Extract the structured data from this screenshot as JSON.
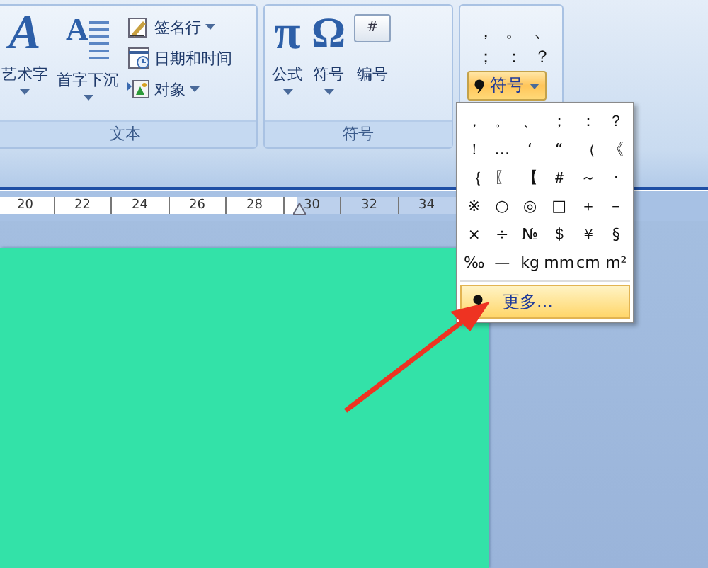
{
  "ribbon": {
    "groups": [
      {
        "label": "文本",
        "items": [
          {
            "kind": "large",
            "icon": "A",
            "label": "艺术字",
            "dropdown": true
          },
          {
            "kind": "large",
            "icon": "A",
            "label": "首字下沉",
            "dropdown": true
          },
          {
            "kind": "small",
            "label": "签名行",
            "dropdown": true
          },
          {
            "kind": "small",
            "label": "日期和时间",
            "dropdown": false
          },
          {
            "kind": "small",
            "label": "对象",
            "dropdown": true
          }
        ]
      },
      {
        "label": "符号",
        "items": [
          {
            "kind": "large",
            "icon": "π",
            "label": "公式",
            "dropdown": true
          },
          {
            "kind": "large",
            "icon": "Ω",
            "label": "符号",
            "dropdown": true
          },
          {
            "kind": "large",
            "icon": "#",
            "label": "编号",
            "dropdown": false
          }
        ]
      }
    ],
    "quick_symbols": [
      "，",
      "。",
      "、",
      "；",
      "：",
      "？"
    ],
    "symbol_button": {
      "label": "符号",
      "open": true
    }
  },
  "symbol_menu": {
    "symbols": [
      "，",
      "。",
      "、",
      "；",
      "：",
      "？",
      "！",
      "…",
      "‘",
      "“",
      "（",
      "《",
      "｛",
      "〖",
      "【",
      "＃",
      "～",
      "·",
      "※",
      "○",
      "◎",
      "□",
      "＋",
      "－",
      "×",
      "÷",
      "№",
      "＄",
      "￥",
      "§",
      "‰",
      "—",
      "kg",
      "mm",
      "cm",
      "m²"
    ],
    "more": {
      "label": "更多...",
      "highlighted": true
    }
  },
  "ruler": {
    "numbers": [
      "20",
      "22",
      "24",
      "26",
      "28",
      "30",
      "32",
      "34"
    ]
  }
}
